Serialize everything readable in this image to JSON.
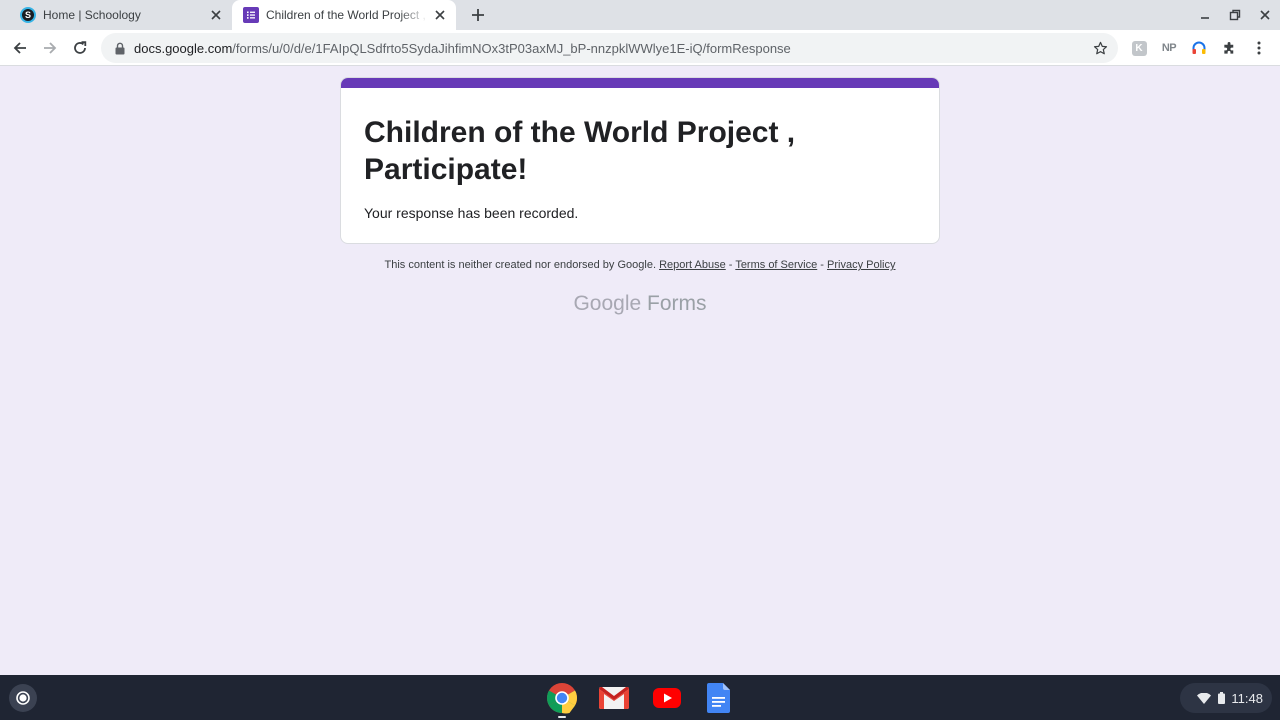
{
  "browser": {
    "tabs": [
      {
        "title": "Home | Schoology",
        "favicon": "schoology-icon",
        "favicon_text": "S",
        "active": false
      },
      {
        "title": "Children of the World Project , Participate!",
        "favicon": "google-forms-icon",
        "active": true
      }
    ],
    "url": {
      "host": "docs.google.com",
      "path": "/forms/u/0/d/e/1FAIpQLSdfrto5SydaJihfimNOx3tP03axMJ_bP-nnzpklWWlye1E-iQ/formResponse"
    },
    "extensions": [
      {
        "icon": "extension-grey-icon",
        "label": "K"
      },
      {
        "icon": "np-extension-icon",
        "label": "NP"
      },
      {
        "icon": "headphones-extension-icon"
      },
      {
        "icon": "puzzle-extensions-icon"
      }
    ]
  },
  "form": {
    "title": "Children of the World Project , Participate!",
    "confirmation": "Your response has been recorded.",
    "accent_color": "#673ab7",
    "background_color": "#efebf8"
  },
  "footer": {
    "disclaimer": "This content is neither created nor endorsed by Google.",
    "links": [
      "Report Abuse",
      "Terms of Service",
      "Privacy Policy"
    ],
    "separator": " - ",
    "brand_google": "Google",
    "brand_product": "Forms"
  },
  "shelf": {
    "apps": [
      "chrome-icon",
      "gmail-icon",
      "youtube-icon",
      "google-docs-icon"
    ],
    "time": "11:48"
  }
}
